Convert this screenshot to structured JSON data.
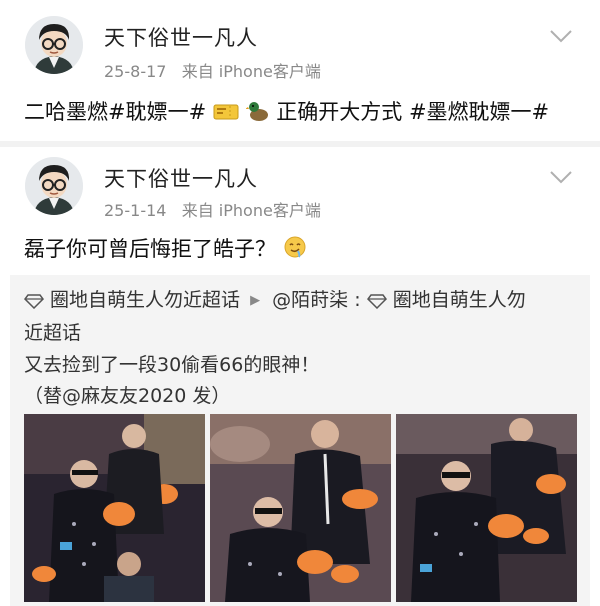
{
  "posts": [
    {
      "author": "天下俗世一凡人",
      "date": "25-8-17",
      "source": "来自 iPhone客户端",
      "text_before_icons": "二哈墨燃#耽嫖一#",
      "text_after_icons": "正确开大方式 #墨燃耽嫖一#",
      "icons": [
        "ticket-emoji",
        "duck-emoji"
      ]
    },
    {
      "author": "天下俗世一凡人",
      "date": "25-1-14",
      "source": "来自 iPhone客户端",
      "text": "磊子你可曾后悔拒了皓子？",
      "emoji": "drooling-face-emoji",
      "repost": {
        "group1": "圈地自萌生人勿近超话",
        "mention": "@陌莳柒 :",
        "group2_line1": "圈地自萌生人勿",
        "group2_line2": "近超话",
        "content_line1": "又去捡到了一段30偷看66的眼神！",
        "content_line2": "（替@麻友友2020 发）",
        "images": [
          "photo-1",
          "photo-2",
          "photo-3"
        ]
      }
    }
  ],
  "colors": {
    "background": "#f2f2f2",
    "card": "#ffffff",
    "repost_bg": "#f4f4f4",
    "meta": "#888888",
    "orange": "#f0873a"
  }
}
